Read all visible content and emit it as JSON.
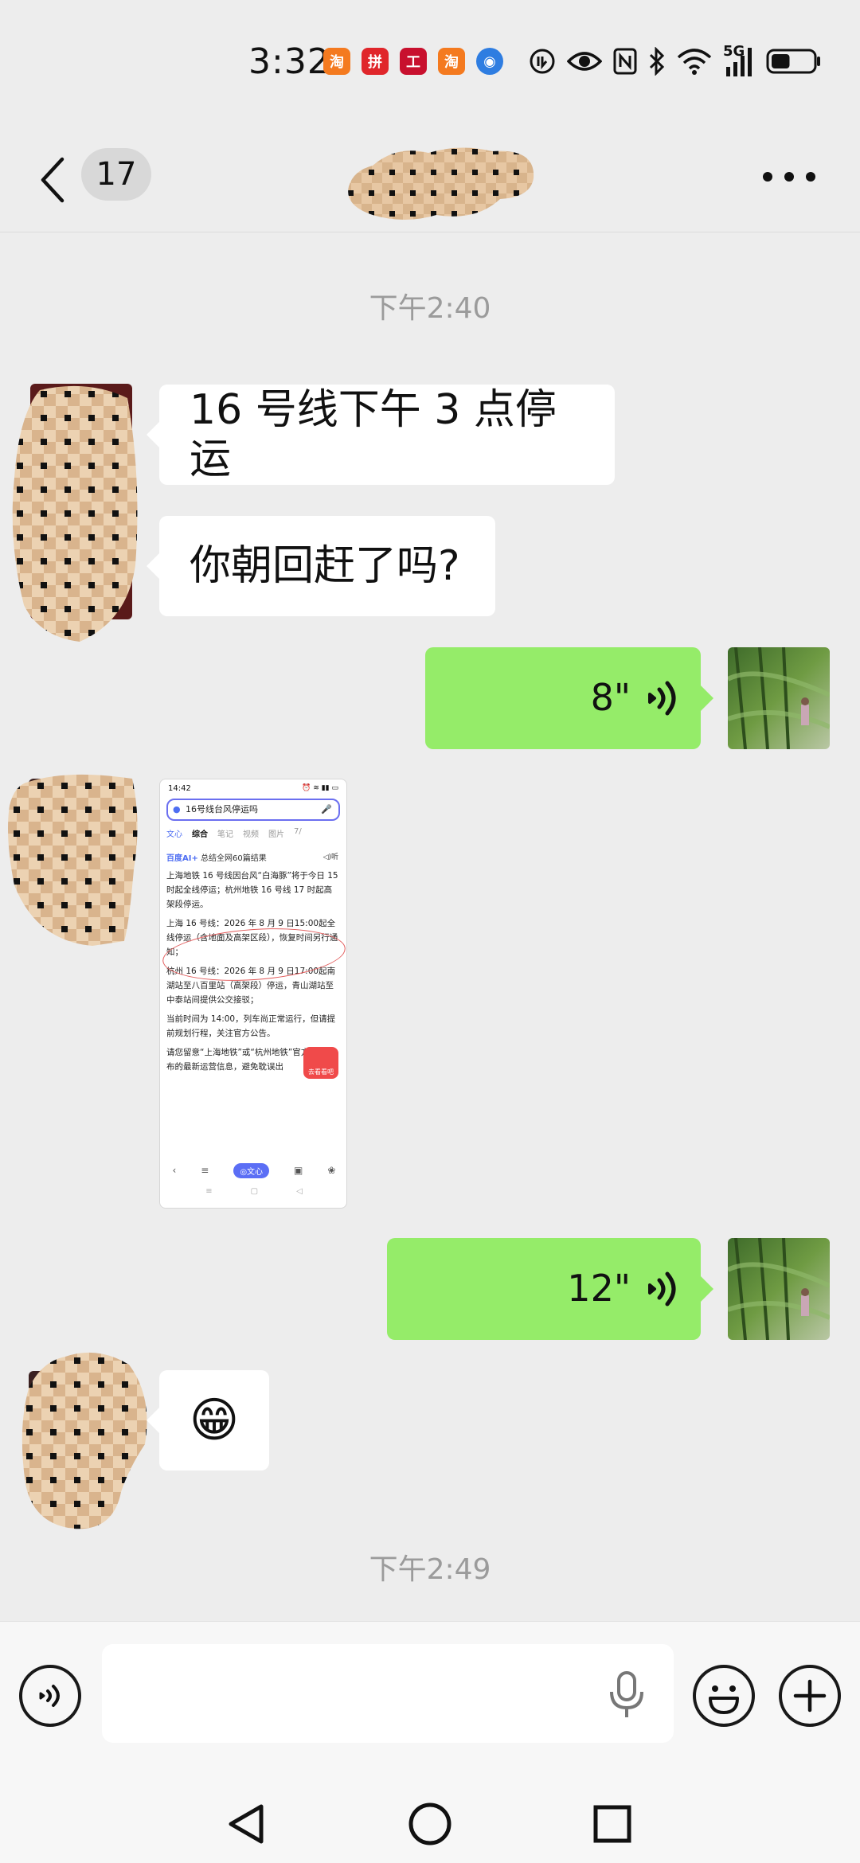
{
  "status_bar": {
    "time": "3:32",
    "network": "5G",
    "notification_icons": [
      {
        "name": "taobao-app-icon",
        "color": "#f47a1f",
        "glyph": "淘"
      },
      {
        "name": "pinduoduo-app-icon",
        "color": "#e0262b",
        "glyph": "拼"
      },
      {
        "name": "bank-app-icon",
        "color": "#c8102e",
        "glyph": "工"
      },
      {
        "name": "taobao-app-icon-2",
        "color": "#f47a1f",
        "glyph": "淘"
      },
      {
        "name": "browser-app-icon",
        "color": "#2e7de1",
        "glyph": "◉"
      }
    ],
    "battery_level": 0.45
  },
  "header": {
    "unread_count": "17",
    "chat_title_redacted": true
  },
  "messages": {
    "timestamp_1": "下午2:40",
    "timestamp_2": "下午2:49",
    "incoming_text_1": "16 号线下午 3 点停运",
    "incoming_text_2": "你朝回赶了吗?",
    "voice_1_duration": "8\"",
    "voice_2_duration": "12\"",
    "sticker": "😁"
  },
  "screenshot_thumbnail": {
    "time": "14:42",
    "search_query": "16号线台风停运吗",
    "tabs": [
      "文心",
      "综合",
      "笔记",
      "视频",
      "图片",
      "7/"
    ],
    "ai_label_brand": "百度AI+",
    "ai_label_text": "总结全网60篇结果",
    "listen_label": "◁)听",
    "summary": "上海地铁 16 号线因台风“白海豚”将于今日 15 时起全线停运；杭州地铁 16 号线 17 时起高架段停运。",
    "bullet_1": "上海 16 号线：2026 年 8 月 9 日15:00起全线停运（含地面及高架区段），恢复时间另行通知；",
    "bullet_2": "杭州 16 号线：2026 年 8 月 9 日17:00起南湖站至八百里站（高架段）停运，青山湖站至中泰站间提供公交接驳；",
    "bullet_3": "当前时间为 14:00，列车尚正常运行，但请提前规划行程，关注官方公告。",
    "footer": "请您留意“上海地铁”或“杭州地铁”官方渠道发布的最新运营信息，避免耽误出",
    "wenxin_btn": "◎文心",
    "badge_label": "去看看吧"
  },
  "input_bar": {
    "message_value": "",
    "placeholder": ""
  },
  "colors": {
    "background": "#ededed",
    "outgoing_bubble": "#95ec69",
    "incoming_bubble": "#ffffff",
    "timestamp": "#9b9b9b"
  }
}
